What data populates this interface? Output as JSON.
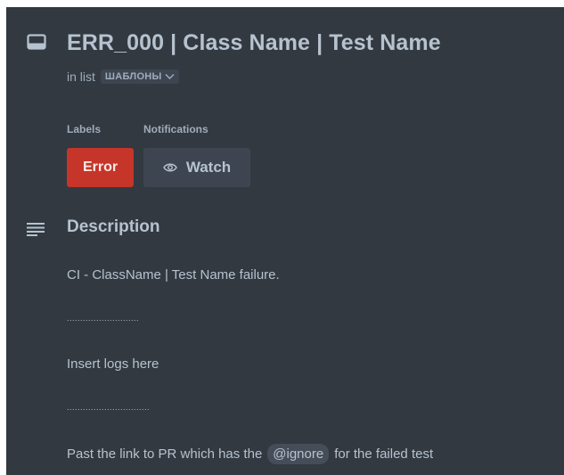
{
  "card": {
    "title": "ERR_000 | Class Name | Test Name",
    "in_list_prefix": "in list",
    "list_name": "ШАБЛОНЫ"
  },
  "labels": {
    "heading": "Labels",
    "items": [
      {
        "text": "Error",
        "color": "#c53529"
      }
    ]
  },
  "notifications": {
    "heading": "Notifications",
    "watch_label": "Watch"
  },
  "description": {
    "heading": "Description",
    "line1": "CI - ClassName | Test Name failure.",
    "dots1": "...........................",
    "line2": "Insert logs here",
    "dots2": "...............................",
    "line3_before": "Past the link to PR which has the",
    "line3_code": "@ignore",
    "line3_after": "for the failed test"
  },
  "icons": [
    "card-icon",
    "chevron-down-icon",
    "eye-icon",
    "description-icon"
  ],
  "colors": {
    "background": "#323940",
    "error_label": "#c53529",
    "button_bg": "#3d4650"
  }
}
